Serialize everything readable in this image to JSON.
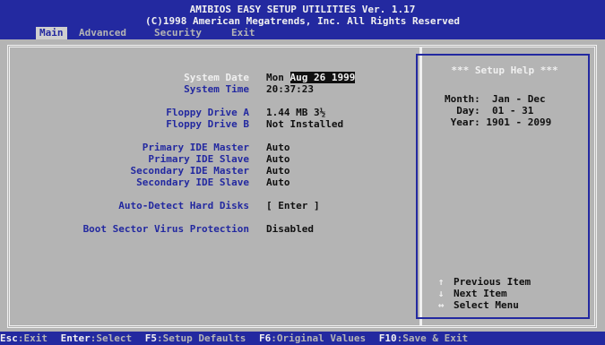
{
  "header": {
    "title": "AMIBIOS EASY SETUP UTILITIES Ver. 1.17",
    "copyright": "(C)1998 American Megatrends, Inc. All Rights Reserved"
  },
  "menu": [
    {
      "label": "Main",
      "active": true
    },
    {
      "label": "Advanced",
      "active": false
    },
    {
      "label": "Security",
      "active": false
    },
    {
      "label": "Exit",
      "active": false
    }
  ],
  "settings": {
    "system_date": {
      "label": "System Date",
      "day": "Mon",
      "value": "Aug 26 1999"
    },
    "system_time": {
      "label": "System Time",
      "value": "20:37:23"
    },
    "floppy_a": {
      "label": "Floppy Drive A",
      "value": "1.44 MB 3½"
    },
    "floppy_b": {
      "label": "Floppy Drive B",
      "value": "Not Installed"
    },
    "primary_master": {
      "label": "Primary IDE Master",
      "value": "Auto"
    },
    "primary_slave": {
      "label": "Primary IDE Slave",
      "value": "Auto"
    },
    "secondary_master": {
      "label": "Secondary IDE Master",
      "value": "Auto"
    },
    "secondary_slave": {
      "label": "Secondary IDE Slave",
      "value": "Auto"
    },
    "auto_detect": {
      "label": "Auto-Detect Hard Disks",
      "value": "[ Enter ]"
    },
    "boot_virus": {
      "label": "Boot Sector Virus Protection",
      "value": "Disabled"
    }
  },
  "help": {
    "title": "*** Setup Help ***",
    "lines": [
      "Month:  Jan - Dec",
      "  Day:  01 - 31",
      " Year: 1901 - 2099"
    ],
    "keys": [
      {
        "symbol": "↑",
        "label": "Previous Item"
      },
      {
        "symbol": "↓",
        "label": "Next Item"
      },
      {
        "symbol": "↔",
        "label": "Select Menu"
      }
    ]
  },
  "footer": [
    {
      "key": "Esc",
      "label": ":Exit"
    },
    {
      "key": "Enter",
      "label": ":Select"
    },
    {
      "key": "F5",
      "label": ":Setup Defaults"
    },
    {
      "key": "F6",
      "label": ":Original Values"
    },
    {
      "key": "F10",
      "label": ":Save & Exit"
    }
  ],
  "colors": {
    "header_bg": "#2329a0",
    "panel_bg": "#b4b4b4",
    "label": "#2329a0",
    "value": "#101010",
    "highlight": "#f0f0f0"
  }
}
